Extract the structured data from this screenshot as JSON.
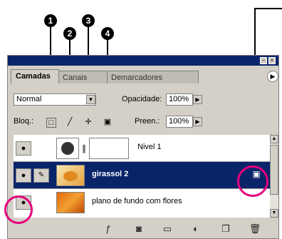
{
  "markers": [
    "1",
    "2",
    "3",
    "4"
  ],
  "panel": {
    "tabs": [
      "Camadas",
      "Canais",
      "Demarcadores"
    ],
    "blend_mode": "Normal",
    "opacity_label": "Opacidade:",
    "opacity_value": "100%",
    "lock_label": "Bloq.:",
    "fill_label": "Preen.:",
    "fill_value": "100%",
    "layers": [
      {
        "name": "Nivel 1"
      },
      {
        "name": "girassol 2",
        "selected": true
      },
      {
        "name": "plano de fundo com flores"
      }
    ]
  },
  "icons": {
    "visibility": "eye-icon",
    "brush": "brush-icon",
    "link": "chain-link-icon",
    "lock_transparency": "transparency-lock-icon",
    "lock_pixels": "pixel-lock-icon",
    "lock_position": "move-lock-icon",
    "lock_all": "padlock-icon",
    "layer_lock": "padlock-icon",
    "menu": "arrow-menu-icon"
  },
  "colors": {
    "selected_row": "#0a246a",
    "highlight_circle": "#e6007e",
    "panel_bg": "#d4d0c8"
  }
}
